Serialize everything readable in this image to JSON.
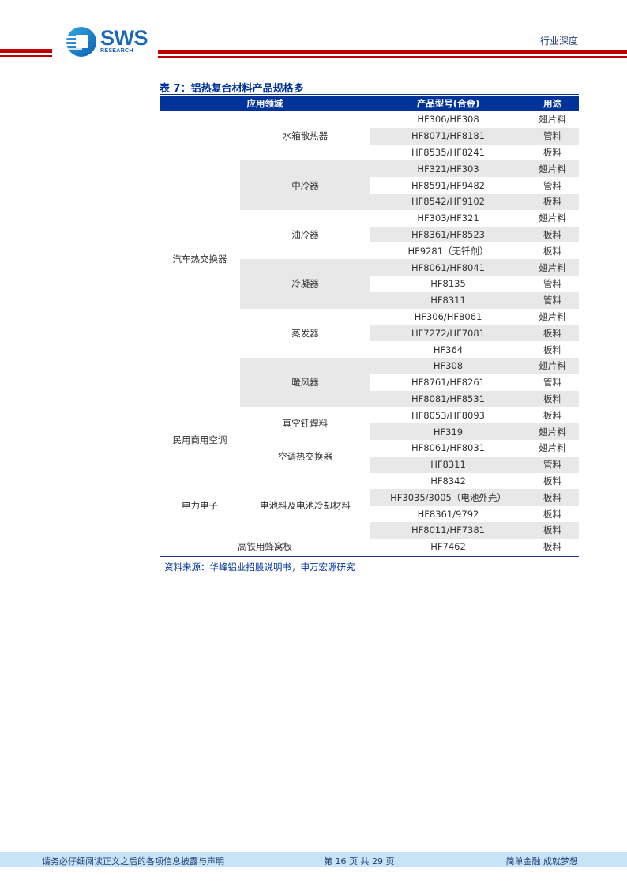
{
  "header": {
    "logo_text": "SWS",
    "logo_subtext": "RESEARCH",
    "doc_type": "行业深度",
    "brand_color": "#c00000",
    "accent_color": "#003399"
  },
  "table": {
    "title": "表 7：铝热复合材料产品规格多",
    "columns": [
      "应用领域",
      "产品型号(合金)",
      "用途"
    ],
    "categories": [
      {
        "name": "汽车热交换器",
        "groups": [
          {
            "name": "水箱散热器",
            "shaded": false,
            "rows": [
              [
                "HF306/HF308",
                "翅片料"
              ],
              [
                "HF8071/HF8181",
                "管料"
              ],
              [
                "HF8535/HF8241",
                "板料"
              ]
            ]
          },
          {
            "name": "中冷器",
            "shaded": true,
            "rows": [
              [
                "HF321/HF303",
                "翅片料"
              ],
              [
                "HF8591/HF9482",
                "管料"
              ],
              [
                "HF8542/HF9102",
                "板料"
              ]
            ]
          },
          {
            "name": "油冷器",
            "shaded": false,
            "rows": [
              [
                "HF303/HF321",
                "翅片料"
              ],
              [
                "HF8361/HF8523",
                "板料"
              ],
              [
                "HF9281（无钎剂）",
                "板料"
              ]
            ]
          },
          {
            "name": "冷凝器",
            "shaded": true,
            "rows": [
              [
                "HF8061/HF8041",
                "翅片料"
              ],
              [
                "HF8135",
                "管料"
              ],
              [
                "HF8311",
                "管料"
              ]
            ]
          },
          {
            "name": "蒸发器",
            "shaded": false,
            "rows": [
              [
                "HF306/HF8061",
                "翅片料"
              ],
              [
                "HF7272/HF7081",
                "板料"
              ],
              [
                "HF364",
                "板料"
              ]
            ]
          },
          {
            "name": "暖风器",
            "shaded": true,
            "rows": [
              [
                "HF308",
                "翅片料"
              ],
              [
                "HF8761/HF8261",
                "管料"
              ],
              [
                "HF8081/HF8531",
                "板料"
              ]
            ]
          }
        ]
      },
      {
        "name": "民用商用空调",
        "groups": [
          {
            "name": "真空钎焊料",
            "shaded": false,
            "rows": [
              [
                "HF8053/HF8093",
                "板料"
              ],
              [
                "HF319",
                "翅片料"
              ]
            ]
          },
          {
            "name": "空调热交换器",
            "shaded": false,
            "rows": [
              [
                "HF8061/HF8031",
                "翅片料"
              ],
              [
                "HF8311",
                "管料"
              ]
            ]
          }
        ]
      },
      {
        "name": "电力电子",
        "groups": [
          {
            "name": "电池料及电池冷却材料",
            "shaded": false,
            "rows": [
              [
                "HF8342",
                "板料"
              ],
              [
                "HF3035/3005（电池外壳）",
                "板料"
              ],
              [
                "HF8361/9792",
                "板料"
              ],
              [
                "HF8011/HF7381",
                "板料"
              ]
            ]
          }
        ]
      },
      {
        "name": "高铁用蜂窝板",
        "merged": true,
        "groups": [
          {
            "name": "高铁用蜂窝板",
            "shaded": false,
            "rows": [
              [
                "HF7462",
                "板料"
              ]
            ]
          }
        ]
      }
    ],
    "source": "资料来源：华峰铝业招股说明书，申万宏源研究"
  },
  "footer": {
    "disclaimer": "请务必仔细阅读正文之后的各项信息披露与声明",
    "page_info": "第 16 页 共 29 页",
    "slogan": "简单金融 成就梦想"
  }
}
